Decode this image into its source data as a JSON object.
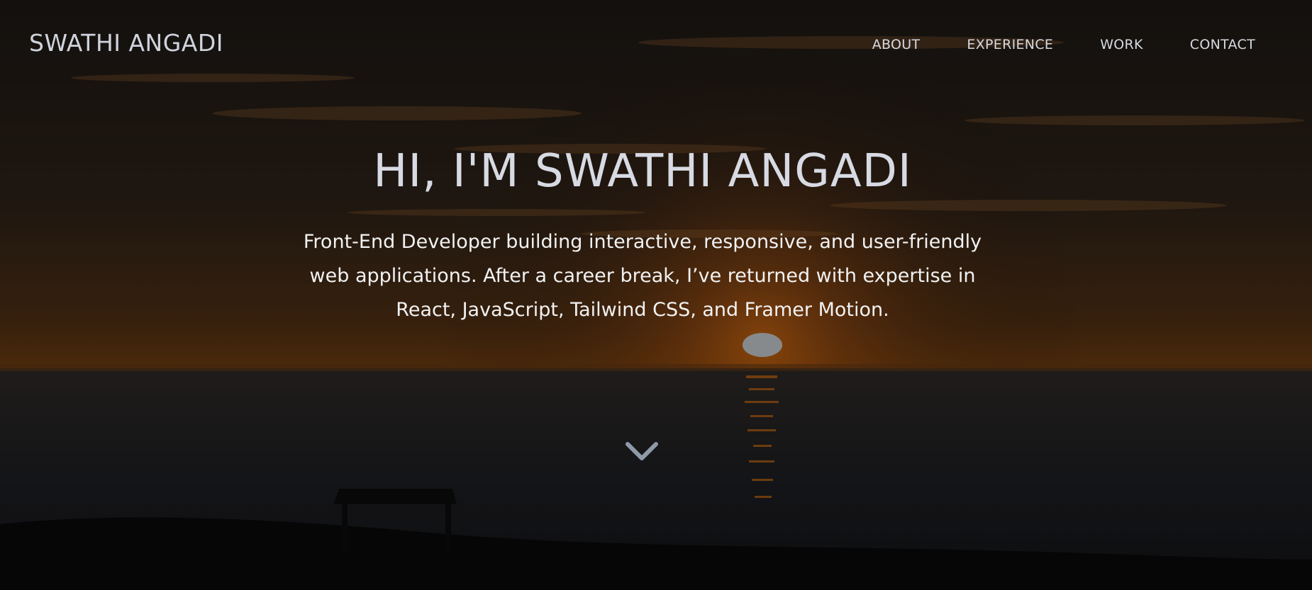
{
  "header": {
    "logo_text": "SWATHI ANGADI",
    "nav": [
      {
        "label": "ABOUT"
      },
      {
        "label": "EXPERIENCE"
      },
      {
        "label": "WORK"
      },
      {
        "label": "CONTACT"
      }
    ]
  },
  "hero": {
    "title": "HI, I'M SWATHI ANGADI",
    "description": "Front-End Developer building interactive, responsive, and user-friendly web applications. After a career break, I’ve returned with expertise in React, JavaScript, Tailwind CSS, and Framer Motion.",
    "scroll_icon": "chevron-down-icon",
    "background": "sunset-over-ocean-photo"
  },
  "colors": {
    "text_primary": "#d7dae3",
    "text_body": "#f2f2f2",
    "chevron": "#8f9aa9",
    "overlay": "#000000"
  }
}
